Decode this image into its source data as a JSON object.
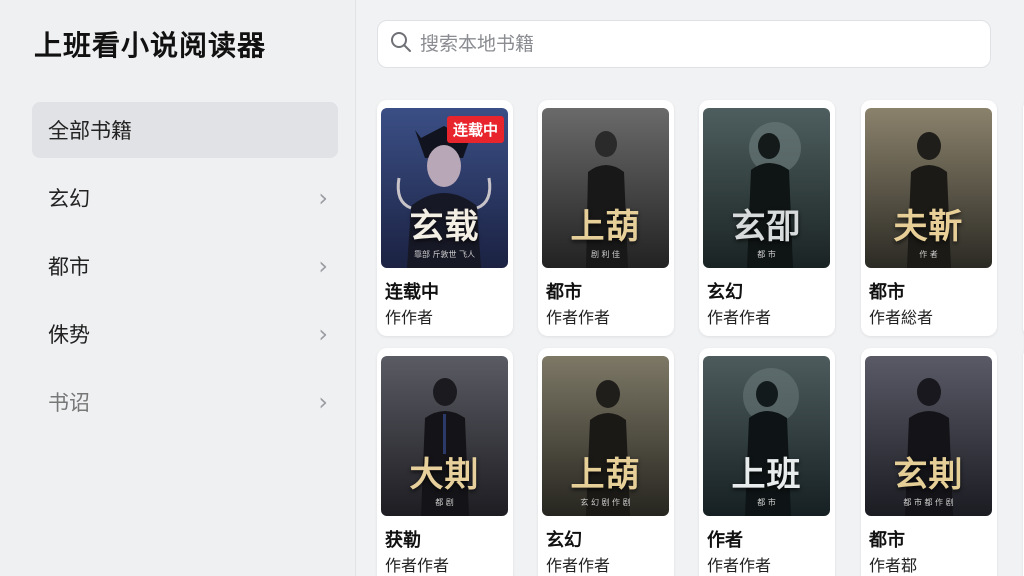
{
  "app": {
    "title": "上班看小说阅读器"
  },
  "sidebar": {
    "items": [
      {
        "label": "全部书籍",
        "active": true,
        "chevron": false
      },
      {
        "label": "玄幻",
        "active": false,
        "chevron": true
      },
      {
        "label": "都市",
        "active": false,
        "chevron": true
      },
      {
        "label": "侏势",
        "active": false,
        "chevron": true
      },
      {
        "label": "书诏",
        "active": false,
        "chevron": true
      }
    ]
  },
  "search": {
    "placeholder": "搜索本地书籍",
    "value": ""
  },
  "books": [
    {
      "cover_title": "玄载",
      "cover_sub": "靠部 斤敦世 飞人",
      "badge": "连载中",
      "name": "连载中",
      "author": "作作者"
    },
    {
      "cover_title": "上葫",
      "cover_sub": "剧 利 佳 ",
      "badge": "",
      "name": "都市",
      "author": "作者作者"
    },
    {
      "cover_title": "玄卲",
      "cover_sub": "都 市",
      "badge": "",
      "name": "玄幻",
      "author": "作者作者"
    },
    {
      "cover_title": "夫靳",
      "cover_sub": "作 者",
      "badge": "",
      "name": "都市",
      "author": "作者総者"
    },
    {
      "cover_title": "大剘",
      "cover_sub": "都 剧",
      "badge": "",
      "name": "获勒",
      "author": "作者作者"
    },
    {
      "cover_title": "上葫",
      "cover_sub": "玄 幻 剧 作 剧",
      "badge": "",
      "name": "玄幻",
      "author": "作者作者"
    },
    {
      "cover_title": "上班",
      "cover_sub": "都 市 ",
      "badge": "",
      "name": "作者",
      "author": "作者作者"
    },
    {
      "cover_title": "玄剘",
      "cover_sub": "都 市 都 作 剧",
      "badge": "",
      "name": "都市",
      "author": "作者鄀"
    }
  ],
  "colors": {
    "badge": "#e8242c",
    "cover_palettes": [
      [
        "#3b4f86",
        "#1b2242",
        "#f4efe4"
      ],
      [
        "#6b6a6a",
        "#222222",
        "#e7cf9a"
      ],
      [
        "#4e5e5e",
        "#1a2323",
        "#d8dbdb"
      ],
      [
        "#8b826c",
        "#2b2a24",
        "#e8cf98"
      ],
      [
        "#5a5b63",
        "#1d1d22",
        "#e7d09c"
      ],
      [
        "#7d7866",
        "#26251f",
        "#e7cf98"
      ],
      [
        "#4d5b5d",
        "#162022",
        "#e8ecec"
      ],
      [
        "#595a66",
        "#1b1b22",
        "#e6cf97"
      ]
    ]
  }
}
